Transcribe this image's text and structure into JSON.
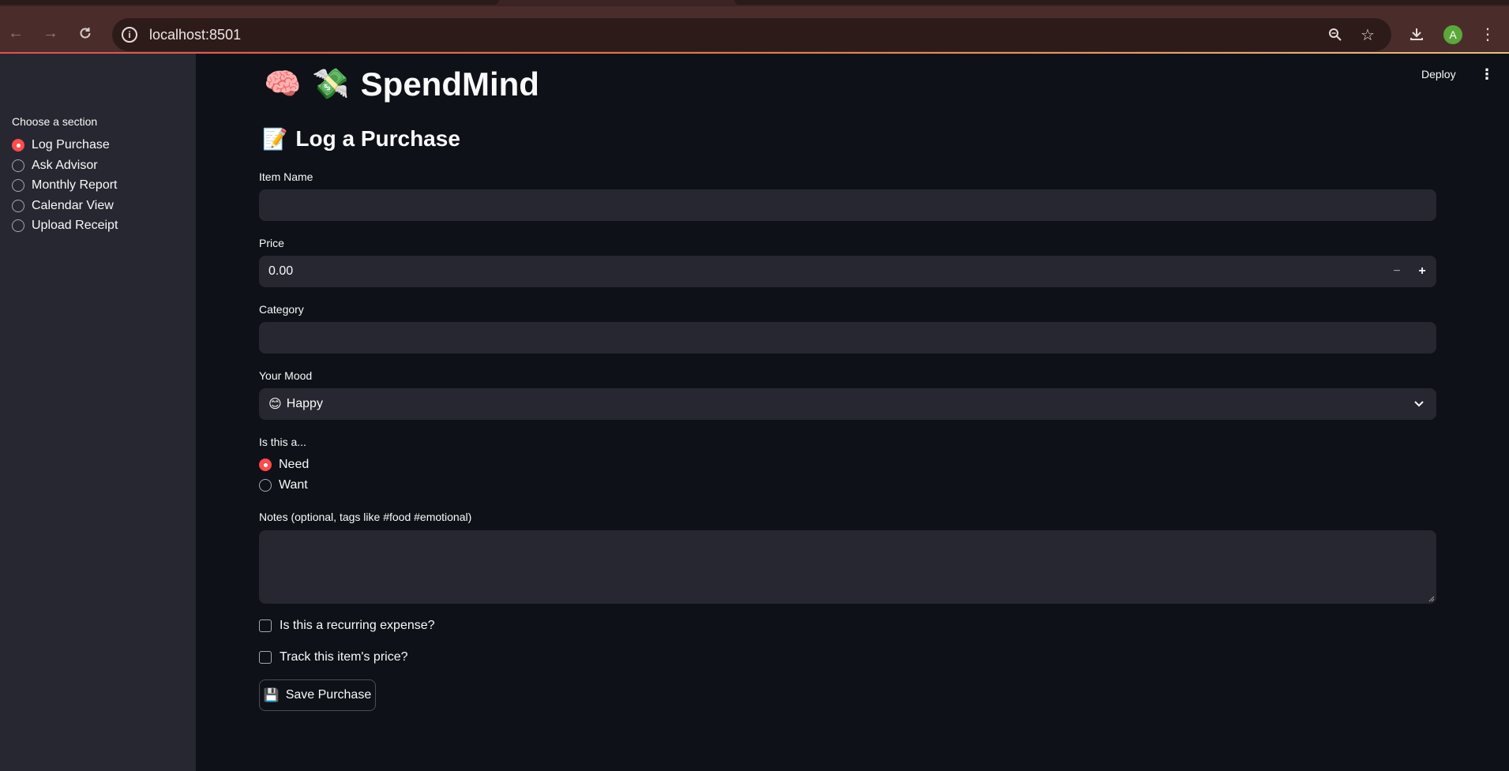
{
  "browser": {
    "url": "localhost:8501",
    "avatar_letter": "A"
  },
  "header": {
    "deploy_label": "Deploy",
    "menu_glyph": "⋮"
  },
  "sidebar": {
    "label": "Choose a section",
    "items": [
      {
        "label": "Log Purchase",
        "selected": true
      },
      {
        "label": "Ask Advisor",
        "selected": false
      },
      {
        "label": "Monthly Report",
        "selected": false
      },
      {
        "label": "Calendar View",
        "selected": false
      },
      {
        "label": "Upload Receipt",
        "selected": false
      }
    ]
  },
  "main": {
    "app_title": "SpendMind",
    "app_title_emojis": [
      "🧠",
      "💸"
    ],
    "section_title": "Log a Purchase",
    "section_emoji": "📝",
    "item_name": {
      "label": "Item Name",
      "value": ""
    },
    "price": {
      "label": "Price",
      "value": "0.00",
      "minus": "−",
      "plus": "+"
    },
    "category": {
      "label": "Category",
      "value": ""
    },
    "mood": {
      "label": "Your Mood",
      "emoji": "😊",
      "value": "Happy"
    },
    "need_want": {
      "label": "Is this a...",
      "options": [
        {
          "label": "Need",
          "selected": true
        },
        {
          "label": "Want",
          "selected": false
        }
      ]
    },
    "notes": {
      "label": "Notes (optional, tags like #food #emotional)",
      "value": ""
    },
    "recurring": {
      "label": "Is this a recurring expense?",
      "checked": false
    },
    "track_price": {
      "label": "Track this item's price?",
      "checked": false
    },
    "save_button": {
      "emoji": "💾",
      "label": "Save Purchase"
    }
  },
  "colors": {
    "accent": "#ff4b4b",
    "background": "#0e1117",
    "sidebar_bg": "#262730",
    "input_bg": "#262730"
  }
}
